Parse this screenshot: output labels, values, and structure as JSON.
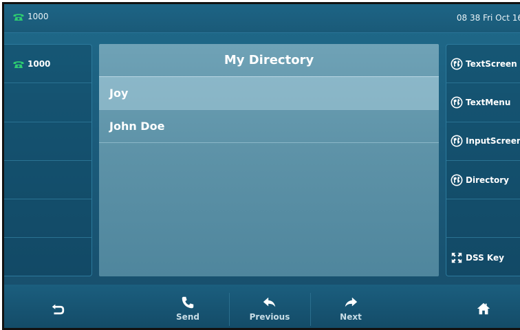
{
  "status": {
    "line_label": "1000",
    "datetime": "08 38 Fri Oct 16"
  },
  "left_lines": [
    {
      "label": "1000",
      "has_icon": true
    },
    {
      "label": ""
    },
    {
      "label": ""
    },
    {
      "label": ""
    },
    {
      "label": ""
    },
    {
      "label": ""
    }
  ],
  "directory": {
    "title": "My Directory",
    "entries": [
      "Joy",
      "John Doe"
    ],
    "selected_index": 0
  },
  "right_keys": [
    {
      "label": "TextScreen",
      "icon": "globe-icon"
    },
    {
      "label": "TextMenu",
      "icon": "globe-icon"
    },
    {
      "label": "InputScreen",
      "icon": "globe-icon"
    },
    {
      "label": "Directory",
      "icon": "globe-icon"
    },
    {
      "label": "",
      "icon": ""
    },
    {
      "label": "DSS Key",
      "icon": "expand-icon"
    }
  ],
  "softkeys": {
    "back_label": "",
    "send_label": "Send",
    "previous_label": "Previous",
    "next_label": "Next",
    "home_label": ""
  },
  "colors": {
    "phone_green": "#2ecc71",
    "accent": "#1d6485"
  }
}
